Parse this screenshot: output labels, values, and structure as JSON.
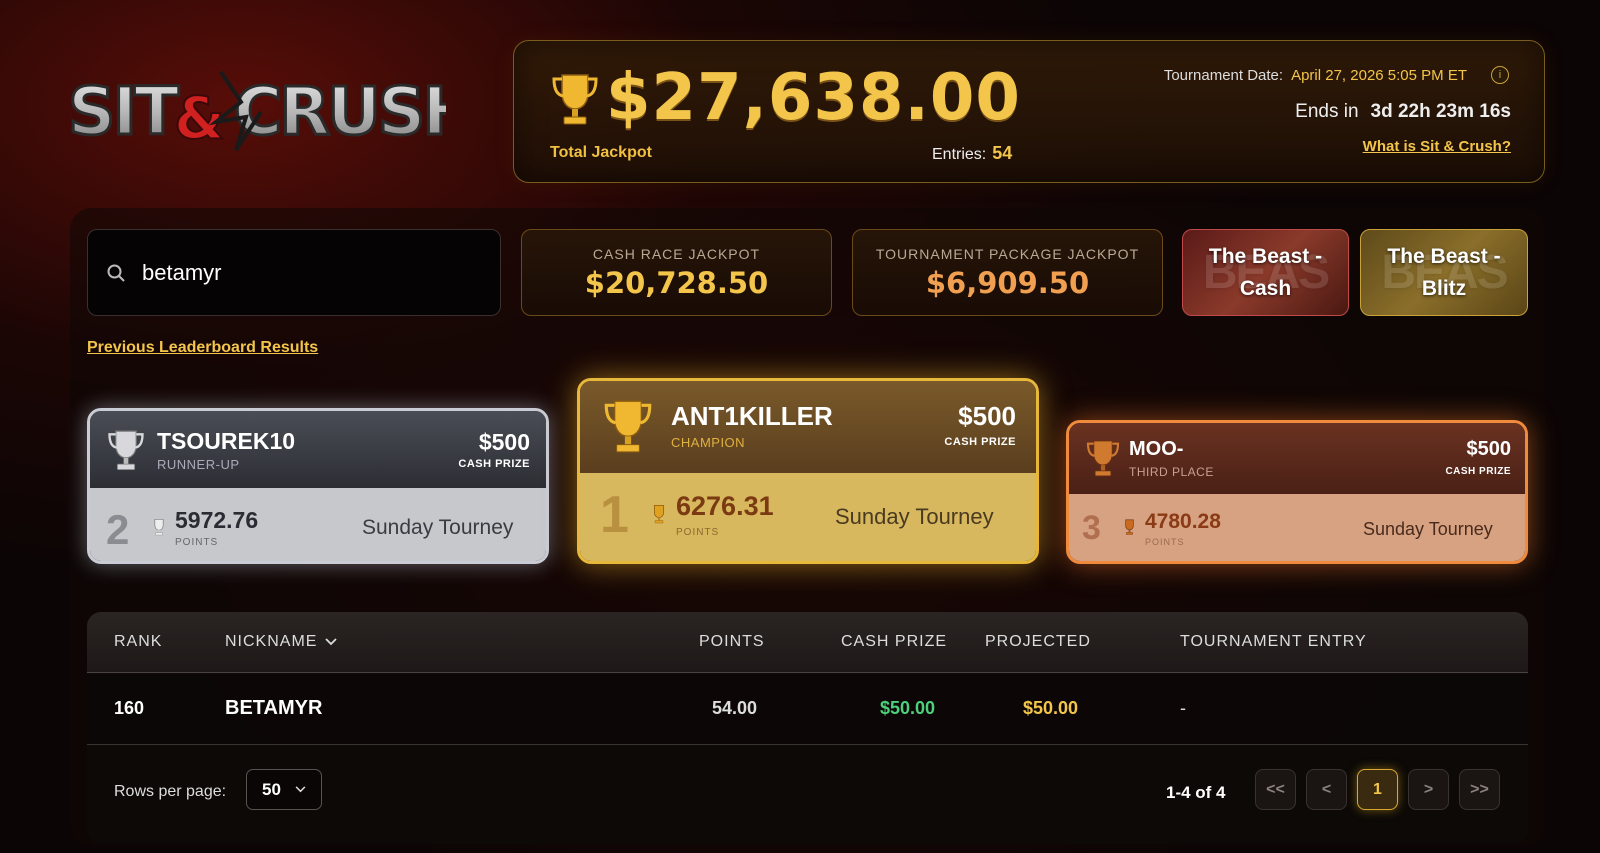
{
  "logo": {
    "text": "SIT&CRUSH"
  },
  "jackpot": {
    "amount": "$27,638.00",
    "label": "Total Jackpot",
    "entries_label": "Entries:",
    "entries_value": "54",
    "date_label": "Tournament Date:",
    "date_value": "April 27, 2026 5:05 PM ET",
    "ends_label": "Ends in",
    "ends_value": "3d 22h 23m 16s",
    "what_link": "What is Sit & Crush?"
  },
  "search": {
    "value": "betamyr",
    "placeholder": ""
  },
  "mini_jackpots": [
    {
      "label": "CASH RACE JACKPOT",
      "value": "$20,728.50",
      "color": "#f3c54a"
    },
    {
      "label": "TOURNAMENT PACKAGE JACKPOT",
      "value": "$6,909.50",
      "color": "#f0a050"
    }
  ],
  "beast_buttons": [
    {
      "label": "The Beast - Cash"
    },
    {
      "label": "The Beast - Blitz"
    }
  ],
  "previous_link": "Previous Leaderboard Results",
  "podium": {
    "second": {
      "name": "TSOUREK10",
      "role": "RUNNER-UP",
      "prize": "$500",
      "prize_label": "CASH PRIZE",
      "rank": "2",
      "points": "5972.76",
      "points_label": "POINTS",
      "tourney": "Sunday Tourney"
    },
    "first": {
      "name": "ANT1KILLER",
      "role": "CHAMPION",
      "prize": "$500",
      "prize_label": "CASH PRIZE",
      "rank": "1",
      "points": "6276.31",
      "points_label": "POINTS",
      "tourney": "Sunday Tourney"
    },
    "third": {
      "name": "MOO-",
      "role": "THIRD PLACE",
      "prize": "$500",
      "prize_label": "CASH PRIZE",
      "rank": "3",
      "points": "4780.28",
      "points_label": "POINTS",
      "tourney": "Sunday Tourney"
    }
  },
  "table": {
    "columns": [
      "RANK",
      "NICKNAME",
      "POINTS",
      "CASH PRIZE",
      "PROJECTED",
      "TOURNAMENT ENTRY"
    ],
    "rows": [
      {
        "rank": "160",
        "nickname": "BETAMYR",
        "points": "54.00",
        "cash_prize": "$50.00",
        "projected": "$50.00",
        "entry": "-"
      }
    ]
  },
  "pagination": {
    "rows_label": "Rows per page:",
    "rows_value": "50",
    "info": "1-4 of 4",
    "first": "<<",
    "prev": "<",
    "current": "1",
    "next": ">",
    "last": ">>"
  }
}
